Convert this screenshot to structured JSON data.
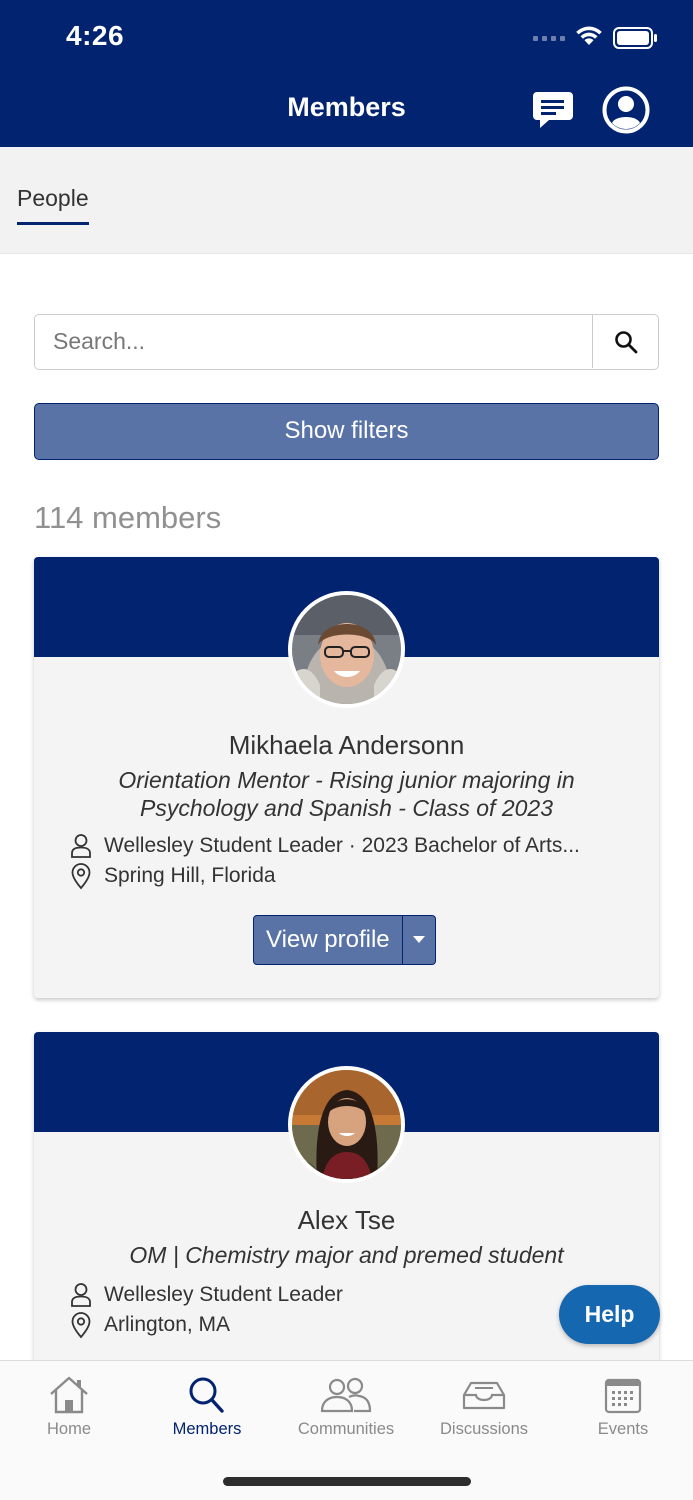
{
  "status_bar": {
    "time": "4:26"
  },
  "header": {
    "title": "Members"
  },
  "tabs": [
    {
      "label": "People"
    }
  ],
  "search": {
    "placeholder": "Search..."
  },
  "filters": {
    "label": "Show filters"
  },
  "results": {
    "count_label": "114 members"
  },
  "members": [
    {
      "name": "Mikhaela Andersonn",
      "headline": "Orientation Mentor - Rising junior majoring in Psychology and Spanish - Class of 2023",
      "affiliation": "Wellesley Student Leader · 2023 Bachelor of Arts...",
      "location": "Spring Hill, Florida",
      "view_profile_label": "View profile"
    },
    {
      "name": "Alex Tse",
      "headline": "OM | Chemistry major and premed student",
      "affiliation": "Wellesley Student Leader",
      "location": "Arlington, MA"
    }
  ],
  "help": {
    "label": "Help"
  },
  "bottom_nav": [
    {
      "label": "Home",
      "icon": "home-icon"
    },
    {
      "label": "Members",
      "icon": "search-icon",
      "active": true
    },
    {
      "label": "Communities",
      "icon": "people-icon"
    },
    {
      "label": "Discussions",
      "icon": "inbox-icon"
    },
    {
      "label": "Events",
      "icon": "calendar-icon"
    }
  ],
  "colors": {
    "brand": "#02236f",
    "button": "#5a73a7",
    "help": "#1567b0",
    "card_bg": "#f4f4f4"
  }
}
